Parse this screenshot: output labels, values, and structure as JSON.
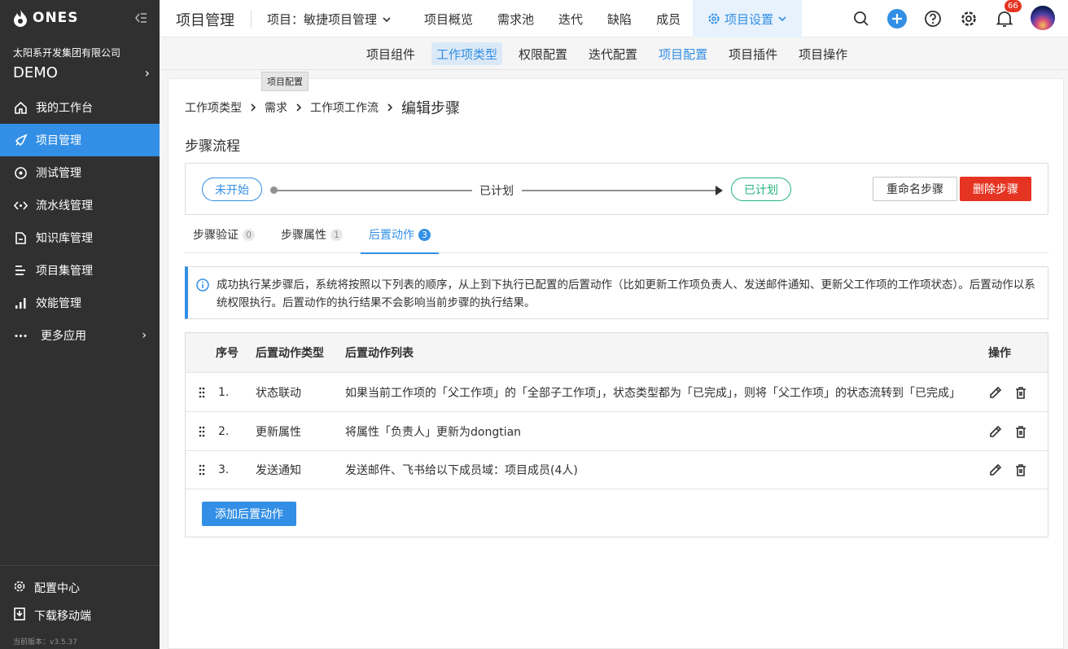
{
  "app": {
    "logo_text": "ONES",
    "title": "项目管理"
  },
  "org": {
    "name": "太阳系开发集团有限公司",
    "code": "DEMO"
  },
  "sidebar": {
    "items": [
      {
        "label": "我的工作台",
        "icon": "home-icon"
      },
      {
        "label": "项目管理",
        "icon": "rocket-icon",
        "active": true
      },
      {
        "label": "测试管理",
        "icon": "test-icon"
      },
      {
        "label": "流水线管理",
        "icon": "pipeline-icon"
      },
      {
        "label": "知识库管理",
        "icon": "wiki-icon"
      },
      {
        "label": "项目集管理",
        "icon": "program-icon"
      },
      {
        "label": "效能管理",
        "icon": "chart-icon"
      },
      {
        "label": "更多应用",
        "icon": "more-icon"
      }
    ],
    "bottom": [
      {
        "label": "配置中心",
        "icon": "gear-icon"
      },
      {
        "label": "下载移动端",
        "icon": "download-icon"
      }
    ],
    "version": "当前版本：v3.5.37"
  },
  "header": {
    "project_selector": "项目：敏捷项目管理",
    "tabs": [
      "项目概览",
      "需求池",
      "迭代",
      "缺陷",
      "成员"
    ],
    "settings_tab": "项目设置",
    "notification_count": "66"
  },
  "subnav": {
    "tabs": [
      "项目组件",
      "工作项类型",
      "权限配置",
      "迭代配置",
      "项目配置",
      "项目插件",
      "项目操作"
    ],
    "tooltip": "项目配置"
  },
  "breadcrumb": {
    "items": [
      "工作项类型",
      "需求",
      "工作项工作流"
    ],
    "current": "编辑步骤"
  },
  "flow": {
    "section_title": "步骤流程",
    "from_state": "未开始",
    "step_name": "已计划",
    "to_state": "已计划",
    "rename_button": "重命名步骤",
    "delete_button": "删除步骤"
  },
  "detail_tabs": [
    {
      "label": "步骤验证",
      "count": "0"
    },
    {
      "label": "步骤属性",
      "count": "1"
    },
    {
      "label": "后置动作",
      "count": "3",
      "active": true
    }
  ],
  "info": {
    "text": "成功执行某步骤后，系统将按照以下列表的顺序，从上到下执行已配置的后置动作（比如更新工作项负责人、发送邮件通知、更新父工作项的工作项状态）。后置动作以系统权限执行。后置动作的执行结果不会影响当前步骤的执行结果。"
  },
  "table": {
    "headers": {
      "no": "序号",
      "type": "后置动作类型",
      "list": "后置动作列表",
      "actions": "操作"
    },
    "rows": [
      {
        "no": "1.",
        "type": "状态联动",
        "desc": "如果当前工作项的「父工作项」的「全部子工作项」，状态类型都为「已完成」，则将「父工作项」的状态流转到「已完成」"
      },
      {
        "no": "2.",
        "type": "更新属性",
        "desc": "将属性「负责人」更新为dongtian"
      },
      {
        "no": "3.",
        "type": "发送通知",
        "desc": "发送邮件、飞书给以下成员域：项目成员(4人)"
      }
    ],
    "add_button": "添加后置动作"
  },
  "colors": {
    "primary": "#338fe5",
    "danger": "#e63422",
    "success": "#24b47e",
    "sidebar": "#303030"
  }
}
